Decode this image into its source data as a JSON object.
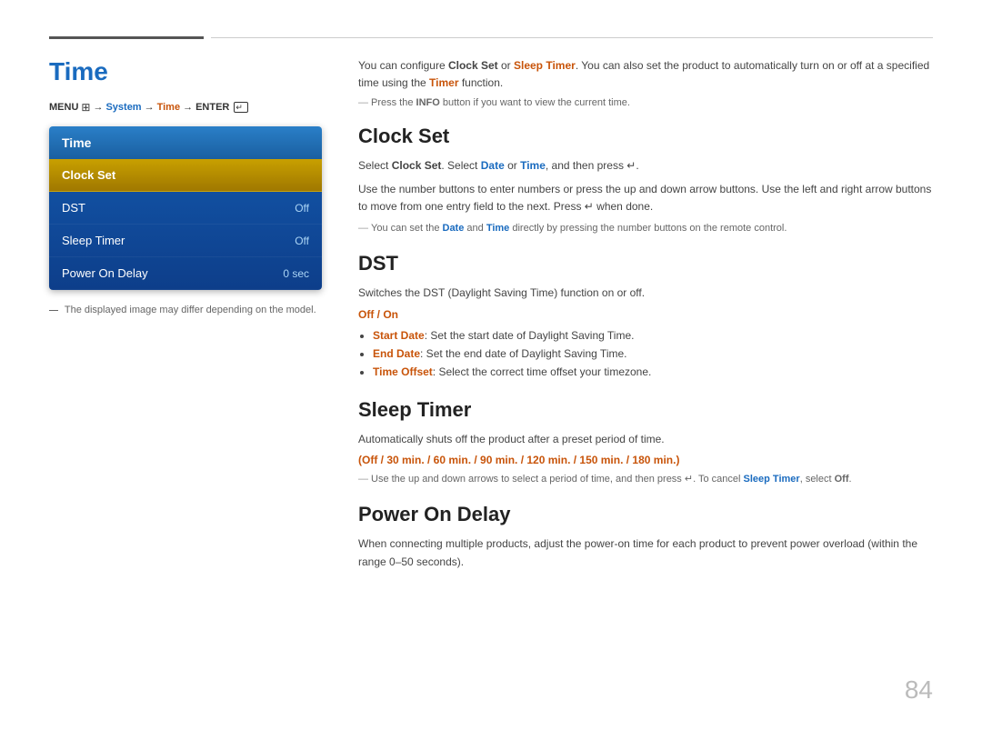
{
  "page": {
    "number": "84",
    "top_divider": true
  },
  "left": {
    "title": "Time",
    "menu_path": {
      "menu": "MENU",
      "menu_icon": "≡",
      "arrow1": "→",
      "system": "System",
      "arrow2": "→",
      "time": "Time",
      "arrow3": "→",
      "enter": "ENTER"
    },
    "tv_menu": {
      "header": "Time",
      "items": [
        {
          "label": "Clock Set",
          "value": "",
          "selected": true
        },
        {
          "label": "DST",
          "value": "Off",
          "selected": false
        },
        {
          "label": "Sleep Timer",
          "value": "Off",
          "selected": false
        },
        {
          "label": "Power On Delay",
          "value": "0 sec",
          "selected": false
        }
      ]
    },
    "note": "The displayed image may differ depending on the model."
  },
  "right": {
    "intro": {
      "text1": "You can configure ",
      "clock_set": "Clock Set",
      "text2": " or ",
      "sleep_timer": "Sleep Timer",
      "text3": ". You can also set the product to automatically turn on or off at a specified time using the ",
      "timer": "Timer",
      "text4": " function."
    },
    "intro_note": "Press the INFO button if you want to view the current time.",
    "sections": [
      {
        "id": "clock-set",
        "title": "Clock Set",
        "paragraphs": [
          {
            "type": "text",
            "content": "Select Clock Set. Select Date or Time, and then press ↵."
          },
          {
            "type": "text",
            "content": "Use the number buttons to enter numbers or press the up and down arrow buttons. Use the left and right arrow buttons to move from one entry field to the next. Press ↵ when done."
          }
        ],
        "note": "You can set the Date and Time directly by pressing the number buttons on the remote control."
      },
      {
        "id": "dst",
        "title": "DST",
        "paragraphs": [
          {
            "type": "text",
            "content": "Switches the DST (Daylight Saving Time) function on or off."
          },
          {
            "type": "orange-options",
            "content": "Off / On"
          }
        ],
        "bullets": [
          {
            "label": "Start Date",
            "text": ": Set the start date of Daylight Saving Time."
          },
          {
            "label": "End Date",
            "text": ": Set the end date of Daylight Saving Time."
          },
          {
            "label": "Time Offset",
            "text": ": Select the correct time offset your timezone."
          }
        ]
      },
      {
        "id": "sleep-timer",
        "title": "Sleep Timer",
        "paragraphs": [
          {
            "type": "text",
            "content": "Automatically shuts off the product after a preset period of time."
          },
          {
            "type": "orange-options",
            "content": "(Off / 30 min. / 60 min. / 90 min. / 120 min. / 150 min. / 180 min.)"
          }
        ],
        "note": "Use the up and down arrows to select a period of time, and then press ↵. To cancel Sleep Timer, select Off."
      },
      {
        "id": "power-on-delay",
        "title": "Power On Delay",
        "paragraphs": [
          {
            "type": "text",
            "content": "When connecting multiple products, adjust the power-on time for each product to prevent power overload (within the range 0–50 seconds)."
          }
        ]
      }
    ]
  }
}
